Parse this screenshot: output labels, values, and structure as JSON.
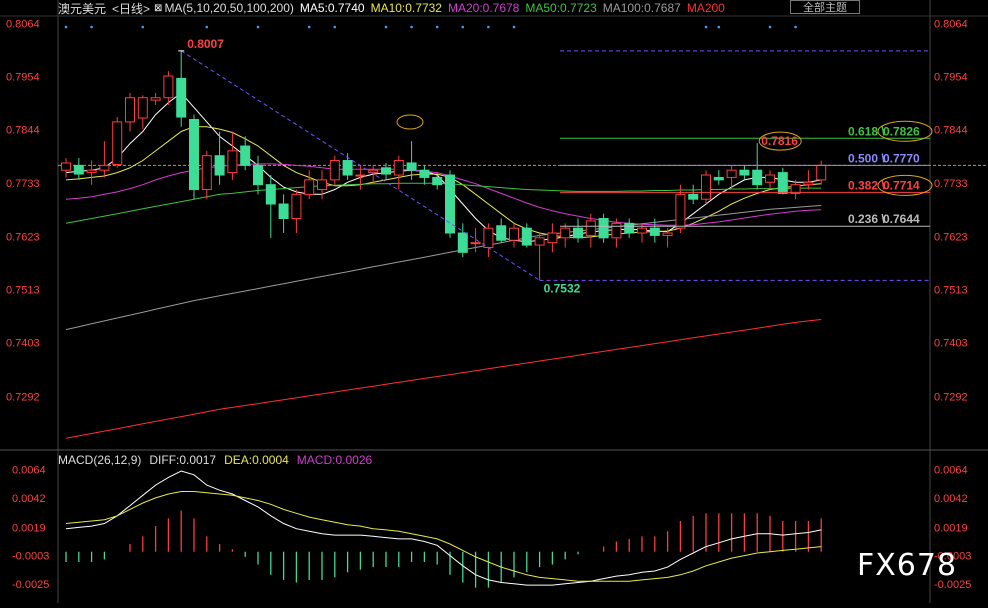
{
  "header": {
    "symbol": "澳元美元",
    "period": "<日线>",
    "ma_label": "MA(5,10,20,50,100,200)",
    "ma5": "MA5:0.7740",
    "ma10": "MA10:0.7732",
    "ma20": "MA20:0.7678",
    "ma50": "MA50:0.7723",
    "ma100": "MA100:0.7687",
    "ma200": "MA200",
    "theme_button": "全部主题"
  },
  "macd_header": {
    "label": "MACD(26,12,9)",
    "diff": "DIFF:0.0017",
    "dea": "DEA:0.0004",
    "macd": "MACD:0.0026"
  },
  "watermark": "FX678",
  "colors": {
    "up": "#ff3b3b",
    "down": "#3ddc97",
    "ma5": "#ffffff",
    "ma10": "#e8e84a",
    "ma20": "#d43bd4",
    "ma50": "#3ec43e",
    "ma100": "#9a9a9a",
    "ma200": "#ff3030",
    "fib618": "#3ec43e",
    "fib500": "#8a8aff",
    "fib382": "#ff4040",
    "fib236": "#bbbbbb",
    "axis_text": "#ff4040"
  },
  "chart_data": [
    {
      "type": "candlestick",
      "y_ticks": [
        "0.8064",
        "0.7954",
        "0.7844",
        "0.7733",
        "0.7623",
        "0.7513",
        "0.7403",
        "0.7292"
      ],
      "ylim": [
        0.7185,
        0.8075
      ],
      "annotations": {
        "high": "0.8007",
        "low": "0.7532",
        "recent_high": "0.7816"
      },
      "fibonacci": [
        {
          "level": "0.618",
          "value": "0.7826",
          "price": 0.7826
        },
        {
          "level": "0.500",
          "value": "0.7770",
          "price": 0.777
        },
        {
          "level": "0.382",
          "value": "0.7714",
          "price": 0.7714
        },
        {
          "level": "0.236",
          "value": "0.7644",
          "price": 0.7644
        }
      ],
      "candles": [
        {
          "o": 0.776,
          "h": 0.7785,
          "l": 0.7745,
          "c": 0.7775
        },
        {
          "o": 0.777,
          "h": 0.7785,
          "l": 0.774,
          "c": 0.7752
        },
        {
          "o": 0.7755,
          "h": 0.778,
          "l": 0.773,
          "c": 0.776
        },
        {
          "o": 0.776,
          "h": 0.782,
          "l": 0.7745,
          "c": 0.777
        },
        {
          "o": 0.7772,
          "h": 0.787,
          "l": 0.7765,
          "c": 0.786
        },
        {
          "o": 0.786,
          "h": 0.792,
          "l": 0.784,
          "c": 0.791
        },
        {
          "o": 0.7868,
          "h": 0.7915,
          "l": 0.7845,
          "c": 0.791
        },
        {
          "o": 0.7905,
          "h": 0.792,
          "l": 0.7895,
          "c": 0.791
        },
        {
          "o": 0.791,
          "h": 0.7965,
          "l": 0.7895,
          "c": 0.7955
        },
        {
          "o": 0.795,
          "h": 0.8007,
          "l": 0.785,
          "c": 0.787
        },
        {
          "o": 0.7865,
          "h": 0.7875,
          "l": 0.77,
          "c": 0.772
        },
        {
          "o": 0.772,
          "h": 0.78,
          "l": 0.77,
          "c": 0.779
        },
        {
          "o": 0.779,
          "h": 0.784,
          "l": 0.773,
          "c": 0.775
        },
        {
          "o": 0.7755,
          "h": 0.784,
          "l": 0.774,
          "c": 0.78
        },
        {
          "o": 0.781,
          "h": 0.783,
          "l": 0.776,
          "c": 0.777
        },
        {
          "o": 0.777,
          "h": 0.779,
          "l": 0.771,
          "c": 0.773
        },
        {
          "o": 0.773,
          "h": 0.775,
          "l": 0.762,
          "c": 0.769
        },
        {
          "o": 0.769,
          "h": 0.771,
          "l": 0.763,
          "c": 0.766
        },
        {
          "o": 0.766,
          "h": 0.772,
          "l": 0.763,
          "c": 0.771
        },
        {
          "o": 0.771,
          "h": 0.776,
          "l": 0.77,
          "c": 0.774
        },
        {
          "o": 0.772,
          "h": 0.776,
          "l": 0.77,
          "c": 0.774
        },
        {
          "o": 0.774,
          "h": 0.779,
          "l": 0.773,
          "c": 0.778
        },
        {
          "o": 0.778,
          "h": 0.7795,
          "l": 0.774,
          "c": 0.775
        },
        {
          "o": 0.775,
          "h": 0.777,
          "l": 0.772,
          "c": 0.775
        },
        {
          "o": 0.7755,
          "h": 0.777,
          "l": 0.7735,
          "c": 0.776
        },
        {
          "o": 0.7765,
          "h": 0.7775,
          "l": 0.774,
          "c": 0.7752
        },
        {
          "o": 0.775,
          "h": 0.779,
          "l": 0.772,
          "c": 0.778
        },
        {
          "o": 0.7775,
          "h": 0.782,
          "l": 0.774,
          "c": 0.776
        },
        {
          "o": 0.776,
          "h": 0.777,
          "l": 0.773,
          "c": 0.7745
        },
        {
          "o": 0.7745,
          "h": 0.775,
          "l": 0.772,
          "c": 0.773
        },
        {
          "o": 0.775,
          "h": 0.776,
          "l": 0.762,
          "c": 0.763
        },
        {
          "o": 0.763,
          "h": 0.765,
          "l": 0.758,
          "c": 0.759
        },
        {
          "o": 0.761,
          "h": 0.764,
          "l": 0.759,
          "c": 0.761
        },
        {
          "o": 0.76,
          "h": 0.765,
          "l": 0.758,
          "c": 0.764
        },
        {
          "o": 0.7645,
          "h": 0.766,
          "l": 0.761,
          "c": 0.7615
        },
        {
          "o": 0.7615,
          "h": 0.765,
          "l": 0.76,
          "c": 0.764
        },
        {
          "o": 0.764,
          "h": 0.765,
          "l": 0.76,
          "c": 0.7605
        },
        {
          "o": 0.7605,
          "h": 0.763,
          "l": 0.7532,
          "c": 0.762
        },
        {
          "o": 0.761,
          "h": 0.765,
          "l": 0.759,
          "c": 0.763
        },
        {
          "o": 0.762,
          "h": 0.765,
          "l": 0.76,
          "c": 0.764
        },
        {
          "o": 0.764,
          "h": 0.766,
          "l": 0.761,
          "c": 0.762
        },
        {
          "o": 0.7625,
          "h": 0.767,
          "l": 0.76,
          "c": 0.7655
        },
        {
          "o": 0.766,
          "h": 0.767,
          "l": 0.761,
          "c": 0.762
        },
        {
          "o": 0.762,
          "h": 0.766,
          "l": 0.76,
          "c": 0.765
        },
        {
          "o": 0.765,
          "h": 0.766,
          "l": 0.762,
          "c": 0.763
        },
        {
          "o": 0.763,
          "h": 0.765,
          "l": 0.761,
          "c": 0.764
        },
        {
          "o": 0.764,
          "h": 0.766,
          "l": 0.761,
          "c": 0.7625
        },
        {
          "o": 0.7625,
          "h": 0.764,
          "l": 0.76,
          "c": 0.763
        },
        {
          "o": 0.764,
          "h": 0.773,
          "l": 0.763,
          "c": 0.771
        },
        {
          "o": 0.771,
          "h": 0.773,
          "l": 0.769,
          "c": 0.77
        },
        {
          "o": 0.77,
          "h": 0.776,
          "l": 0.769,
          "c": 0.775
        },
        {
          "o": 0.7745,
          "h": 0.776,
          "l": 0.773,
          "c": 0.774
        },
        {
          "o": 0.7745,
          "h": 0.777,
          "l": 0.772,
          "c": 0.776
        },
        {
          "o": 0.776,
          "h": 0.777,
          "l": 0.774,
          "c": 0.775
        },
        {
          "o": 0.776,
          "h": 0.7816,
          "l": 0.772,
          "c": 0.773
        },
        {
          "o": 0.7735,
          "h": 0.776,
          "l": 0.772,
          "c": 0.775
        },
        {
          "o": 0.7755,
          "h": 0.7765,
          "l": 0.771,
          "c": 0.7712
        },
        {
          "o": 0.7712,
          "h": 0.774,
          "l": 0.77,
          "c": 0.773
        },
        {
          "o": 0.773,
          "h": 0.776,
          "l": 0.772,
          "c": 0.7735
        },
        {
          "o": 0.774,
          "h": 0.778,
          "l": 0.773,
          "c": 0.777
        }
      ],
      "moving_averages": {
        "ma5": [
          0.7755,
          0.7758,
          0.776,
          0.7765,
          0.7785,
          0.7815,
          0.784,
          0.7875,
          0.79,
          0.792,
          0.789,
          0.786,
          0.783,
          0.781,
          0.779,
          0.777,
          0.7745,
          0.7725,
          0.7715,
          0.771,
          0.771,
          0.772,
          0.7735,
          0.7745,
          0.7752,
          0.7755,
          0.7758,
          0.776,
          0.7758,
          0.775,
          0.772,
          0.769,
          0.766,
          0.7635,
          0.762,
          0.7615,
          0.7612,
          0.7615,
          0.7618,
          0.7622,
          0.7628,
          0.7632,
          0.7635,
          0.7637,
          0.7638,
          0.7636,
          0.7634,
          0.7633,
          0.765,
          0.767,
          0.769,
          0.771,
          0.7725,
          0.774,
          0.7745,
          0.7745,
          0.774,
          0.7735,
          0.7735,
          0.774
        ],
        "ma10": [
          0.774,
          0.7742,
          0.7745,
          0.7748,
          0.7755,
          0.7765,
          0.778,
          0.78,
          0.782,
          0.784,
          0.785,
          0.785,
          0.7845,
          0.7838,
          0.7825,
          0.781,
          0.779,
          0.777,
          0.7755,
          0.7745,
          0.7735,
          0.7728,
          0.7728,
          0.773,
          0.7735,
          0.774,
          0.7745,
          0.775,
          0.7752,
          0.7752,
          0.7745,
          0.773,
          0.771,
          0.769,
          0.767,
          0.765,
          0.7638,
          0.763,
          0.7625,
          0.7622,
          0.762,
          0.7622,
          0.7625,
          0.7628,
          0.763,
          0.7632,
          0.7633,
          0.7634,
          0.764,
          0.765,
          0.7662,
          0.7675,
          0.769,
          0.7702,
          0.7712,
          0.772,
          0.7724,
          0.7727,
          0.773,
          0.7732
        ],
        "ma20": [
          0.77,
          0.7702,
          0.7705,
          0.771,
          0.7715,
          0.7722,
          0.773,
          0.774,
          0.7748,
          0.7755,
          0.776,
          0.7765,
          0.7768,
          0.777,
          0.7772,
          0.7773,
          0.7773,
          0.7772,
          0.777,
          0.7768,
          0.7765,
          0.7762,
          0.7762,
          0.7762,
          0.7762,
          0.7762,
          0.7762,
          0.776,
          0.7758,
          0.7755,
          0.7748,
          0.774,
          0.7732,
          0.7722,
          0.7712,
          0.7702,
          0.7692,
          0.7683,
          0.7676,
          0.767,
          0.7665,
          0.766,
          0.7656,
          0.7652,
          0.765,
          0.7648,
          0.7647,
          0.7646,
          0.7646,
          0.7647,
          0.765,
          0.7653,
          0.7657,
          0.7661,
          0.7665,
          0.7669,
          0.7672,
          0.7675,
          0.7677,
          0.7678
        ],
        "ma50": [
          0.765,
          0.7655,
          0.766,
          0.7665,
          0.767,
          0.7675,
          0.768,
          0.7685,
          0.769,
          0.7695,
          0.77,
          0.7705,
          0.771,
          0.7712,
          0.7715,
          0.7718,
          0.772,
          0.7722,
          0.7724,
          0.7726,
          0.7728,
          0.7729,
          0.773,
          0.7731,
          0.7732,
          0.7732,
          0.7733,
          0.7733,
          0.7733,
          0.7733,
          0.7732,
          0.773,
          0.7728,
          0.7726,
          0.7724,
          0.7722,
          0.772,
          0.7719,
          0.7718,
          0.7717,
          0.7716,
          0.7716,
          0.7716,
          0.7716,
          0.7717,
          0.7717,
          0.7718,
          0.7718,
          0.7719,
          0.7719,
          0.772,
          0.772,
          0.7721,
          0.7721,
          0.7722,
          0.7722,
          0.7722,
          0.7723,
          0.7723,
          0.7723
        ],
        "ma100": [
          0.743,
          0.7436,
          0.7442,
          0.7448,
          0.7454,
          0.746,
          0.7466,
          0.7472,
          0.7478,
          0.7484,
          0.749,
          0.7495,
          0.75,
          0.7505,
          0.751,
          0.7515,
          0.752,
          0.7525,
          0.753,
          0.7535,
          0.754,
          0.7545,
          0.755,
          0.7555,
          0.756,
          0.7565,
          0.757,
          0.7575,
          0.758,
          0.7585,
          0.759,
          0.7595,
          0.76,
          0.7605,
          0.761,
          0.7615,
          0.762,
          0.7625,
          0.7628,
          0.7631,
          0.7634,
          0.7637,
          0.764,
          0.7643,
          0.7646,
          0.7649,
          0.7652,
          0.7655,
          0.7658,
          0.7661,
          0.7664,
          0.7667,
          0.767,
          0.7673,
          0.7676,
          0.7679,
          0.7681,
          0.7683,
          0.7685,
          0.7687
        ],
        "ma200": [
          0.7205,
          0.721,
          0.7215,
          0.722,
          0.7225,
          0.723,
          0.7235,
          0.724,
          0.7245,
          0.725,
          0.7255,
          0.726,
          0.7265,
          0.7269,
          0.7273,
          0.7277,
          0.7281,
          0.7285,
          0.7289,
          0.7293,
          0.7297,
          0.7301,
          0.7305,
          0.7309,
          0.7313,
          0.7317,
          0.7321,
          0.7325,
          0.7329,
          0.7333,
          0.7337,
          0.7341,
          0.7345,
          0.7349,
          0.7353,
          0.7357,
          0.7361,
          0.7365,
          0.7369,
          0.7373,
          0.7377,
          0.7381,
          0.7385,
          0.7389,
          0.7393,
          0.7397,
          0.7401,
          0.7405,
          0.7409,
          0.7413,
          0.7417,
          0.7421,
          0.7425,
          0.7429,
          0.7433,
          0.7437,
          0.7441,
          0.7445,
          0.7448,
          0.7451
        ]
      }
    },
    {
      "type": "macd",
      "y_ticks": [
        "0.0064",
        "0.0042",
        "0.0019",
        "-0.0003",
        "-0.0025"
      ],
      "ylim": [
        -0.004,
        0.007
      ],
      "diff": [
        0.0018,
        0.0019,
        0.002,
        0.0022,
        0.0028,
        0.0036,
        0.0044,
        0.0052,
        0.0058,
        0.0063,
        0.006,
        0.0052,
        0.0048,
        0.0045,
        0.004,
        0.0035,
        0.0028,
        0.0022,
        0.0018,
        0.0016,
        0.0014,
        0.0013,
        0.0013,
        0.0013,
        0.0012,
        0.0011,
        0.001,
        0.001,
        0.0008,
        0.0005,
        -0.0003,
        -0.0011,
        -0.0018,
        -0.0022,
        -0.0024,
        -0.0025,
        -0.0026,
        -0.0026,
        -0.0026,
        -0.0025,
        -0.0024,
        -0.0023,
        -0.0021,
        -0.0019,
        -0.0018,
        -0.0016,
        -0.0015,
        -0.0012,
        -0.0006,
        -0.0001,
        0.0004,
        0.0007,
        0.001,
        0.0012,
        0.0014,
        0.0014,
        0.0013,
        0.0014,
        0.0015,
        0.0017
      ],
      "dea": [
        0.0022,
        0.0023,
        0.0024,
        0.0025,
        0.0028,
        0.0033,
        0.0038,
        0.0042,
        0.0045,
        0.0047,
        0.0047,
        0.0046,
        0.0045,
        0.0044,
        0.0042,
        0.004,
        0.0037,
        0.0033,
        0.003,
        0.0027,
        0.0025,
        0.0023,
        0.0021,
        0.002,
        0.0018,
        0.0017,
        0.0016,
        0.0014,
        0.0012,
        0.001,
        0.0006,
        0.0001,
        -0.0004,
        -0.0008,
        -0.0012,
        -0.0015,
        -0.0018,
        -0.002,
        -0.0021,
        -0.0022,
        -0.0023,
        -0.0023,
        -0.0023,
        -0.0023,
        -0.0023,
        -0.0022,
        -0.0021,
        -0.002,
        -0.0018,
        -0.0015,
        -0.0011,
        -0.0008,
        -0.0005,
        -0.0003,
        -0.0001,
        0.0,
        0.0001,
        0.0002,
        0.0003,
        0.0004
      ],
      "hist": [
        -0.0008,
        -0.0008,
        -0.0008,
        -0.0006,
        0.0,
        0.0006,
        0.0012,
        0.002,
        0.0026,
        0.0032,
        0.0026,
        0.0012,
        0.0006,
        0.0002,
        -0.0004,
        -0.001,
        -0.0018,
        -0.0022,
        -0.0024,
        -0.0022,
        -0.0022,
        -0.002,
        -0.0016,
        -0.0014,
        -0.0012,
        -0.0012,
        -0.0012,
        -0.0008,
        -0.0008,
        -0.001,
        -0.0018,
        -0.0024,
        -0.0028,
        -0.0028,
        -0.0024,
        -0.002,
        -0.0016,
        -0.0012,
        -0.001,
        -0.0006,
        -0.0002,
        0.0,
        0.0004,
        0.0008,
        0.001,
        0.0012,
        0.0012,
        0.0016,
        0.0024,
        0.0028,
        0.003,
        0.003,
        0.003,
        0.003,
        0.003,
        0.0028,
        0.0024,
        0.0024,
        0.0024,
        0.0026
      ]
    }
  ]
}
